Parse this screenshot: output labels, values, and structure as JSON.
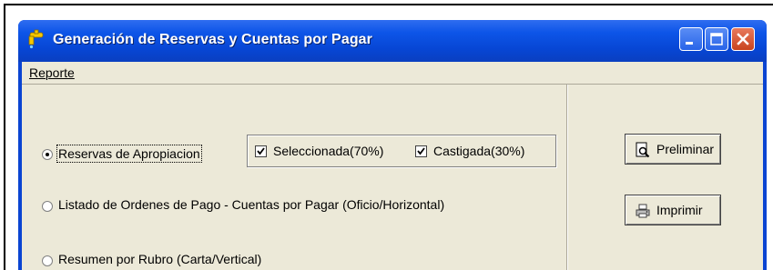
{
  "window": {
    "title": "Generación de Reservas y Cuentas por Pagar",
    "title_color": "#ffffff",
    "titlebar_color": "#0a44d2",
    "client_bg": "#ece9d8"
  },
  "menu": {
    "items": [
      {
        "label": "Reporte"
      }
    ]
  },
  "options": [
    {
      "label": "Reservas de Apropiacion",
      "selected": true
    },
    {
      "label": "Listado de Ordenes de Pago - Cuentas por Pagar (Oficio/Horizontal)",
      "selected": false
    },
    {
      "label": "Resumen por Rubro (Carta/Vertical)",
      "selected": false
    }
  ],
  "checkboxes": [
    {
      "label": "Seleccionada(70%)",
      "checked": true
    },
    {
      "label": "Castigada(30%)",
      "checked": true
    }
  ],
  "buttons": {
    "preview": {
      "label": "Preliminar",
      "icon": "magnifier-document-icon"
    },
    "print": {
      "label": "Imprimir",
      "icon": "printer-icon"
    }
  }
}
